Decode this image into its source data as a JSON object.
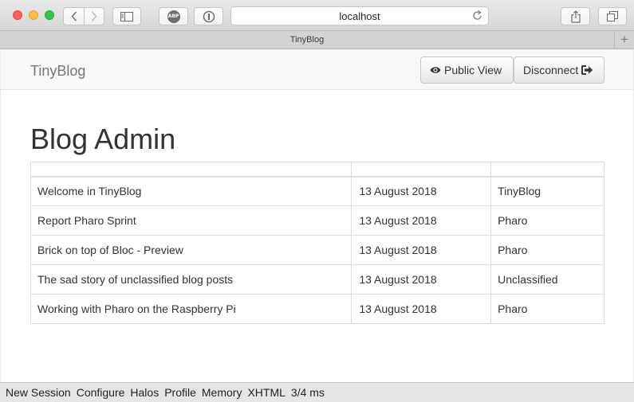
{
  "browser": {
    "url": "localhost",
    "tab_title": "TinyBlog",
    "new_tab_symbol": "+"
  },
  "navbar": {
    "brand": "TinyBlog",
    "public_view_label": "Public View",
    "disconnect_label": "Disconnect"
  },
  "main": {
    "title": "Blog Admin",
    "headers": [
      "",
      "",
      ""
    ],
    "posts": [
      {
        "title": "Welcome in TinyBlog",
        "date": "13 August 2018",
        "category": "TinyBlog"
      },
      {
        "title": "Report Pharo Sprint",
        "date": "13 August 2018",
        "category": "Pharo"
      },
      {
        "title": "Brick on top of Bloc - Preview",
        "date": "13 August 2018",
        "category": "Pharo"
      },
      {
        "title": "The sad story of unclassified blog posts",
        "date": "13 August 2018",
        "category": "Unclassified"
      },
      {
        "title": "Working with Pharo on the Raspberry Pi",
        "date": "13 August 2018",
        "category": "Pharo"
      }
    ]
  },
  "seaside_toolbar": {
    "items": [
      "New Session",
      "Configure",
      "Halos",
      "Profile",
      "Memory",
      "XHTML"
    ],
    "timing": "3/4 ms"
  },
  "icons": {
    "public_view": "eye-icon",
    "disconnect": "sign-out-icon"
  }
}
